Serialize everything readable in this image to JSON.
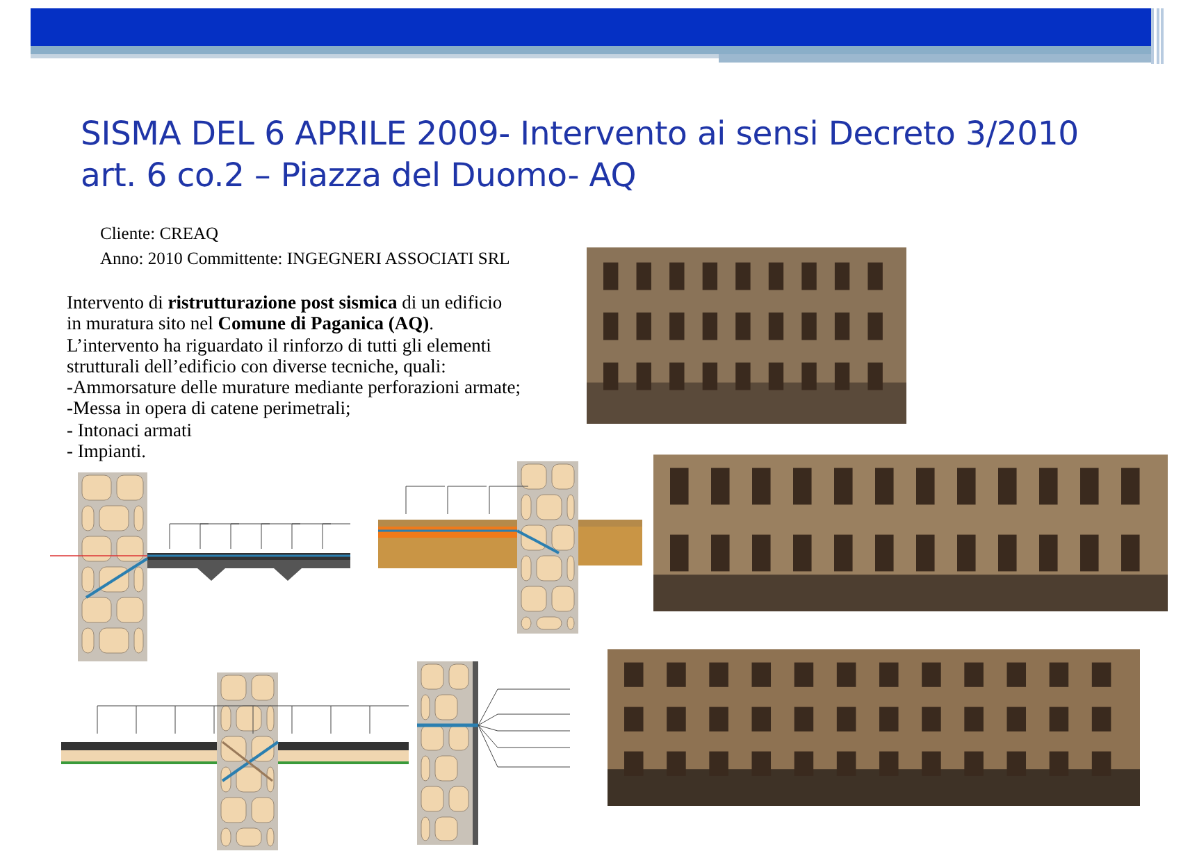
{
  "title": {
    "lines": [
      "SISMA DEL 6 APRILE 2009- Intervento ai sensi Decreto 3/2010",
      "art. 6 co.2 – Piazza del Duomo- AQ"
    ]
  },
  "meta": [
    "Cliente:  CREAQ",
    "Anno: 2010  Committente: INGEGNERI ASSOCIATI SRL"
  ],
  "description": [
    "Intervento di **ristrutturazione post sismica** di un edificio",
    "in muratura sito nel **Comune di Paganica (AQ)**.",
    "L’intervento ha riguardato il rinforzo di tutti gli elementi",
    "strutturali dell’edificio con diverse tecniche, quali:",
    "-Ammorsature delle murature mediante perforazioni armate;",
    "-Messa in opera di catene perimetrali;",
    "- Intonaci armati",
    "- Impianti."
  ]
}
